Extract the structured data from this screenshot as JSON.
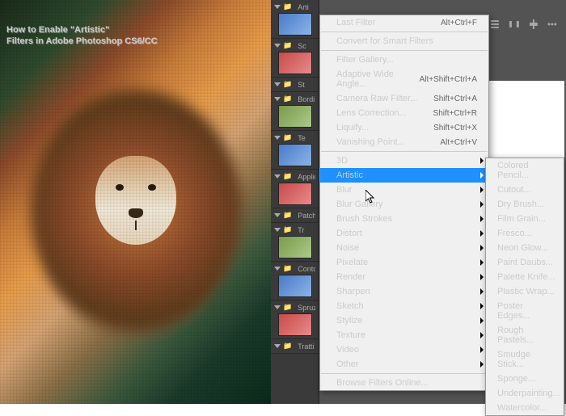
{
  "overlay": {
    "line1": "How to Enable \"Artistic\"",
    "line2": "Filters in Adobe Photoshop CS6/CC"
  },
  "panels": {
    "groups": [
      {
        "label": "Arti",
        "thumbs": 1
      },
      {
        "label": "Sc",
        "thumbs": 1
      },
      {
        "label": "St",
        "thumbs": 0
      },
      {
        "label": "Bordi brill",
        "thumbs": 1
      },
      {
        "label": "Te",
        "thumbs": 1
      },
      {
        "label": "Applica te",
        "thumbs": 1
      },
      {
        "label": "Patch",
        "thumbs": 0
      },
      {
        "label": "Tr",
        "thumbs": 1
      },
      {
        "label": "Contorni ac",
        "thumbs": 1
      },
      {
        "label": "Spruzz",
        "thumbs": 1
      },
      {
        "label": "Tratti ad",
        "thumbs": 0
      }
    ]
  },
  "filter_menu": {
    "last_filter": {
      "label": "Last Filter",
      "shortcut": "Alt+Ctrl+F"
    },
    "convert": "Convert for Smart Filters",
    "gallery": "Filter Gallery...",
    "adaptive": {
      "label": "Adaptive Wide Angle...",
      "shortcut": "Alt+Shift+Ctrl+A"
    },
    "camera_raw": {
      "label": "Camera Raw Filter...",
      "shortcut": "Shift+Ctrl+A"
    },
    "lens": {
      "label": "Lens Correction...",
      "shortcut": "Shift+Ctrl+R"
    },
    "liquify": {
      "label": "Liquify...",
      "shortcut": "Shift+Ctrl+X"
    },
    "vanishing": {
      "label": "Vanishing Point...",
      "shortcut": "Alt+Ctrl+V"
    },
    "categories": [
      "3D",
      "Artistic",
      "Blur",
      "Blur Gallery",
      "Brush Strokes",
      "Distort",
      "Noise",
      "Pixelate",
      "Render",
      "Sharpen",
      "Sketch",
      "Stylize",
      "Texture",
      "Video",
      "Other"
    ],
    "browse": "Browse Filters Online..."
  },
  "artistic_submenu": [
    "Colored Pencil...",
    "Cutout...",
    "Dry Brush...",
    "Film Grain...",
    "Fresco...",
    "Neon Glow...",
    "Paint Daubs...",
    "Palette Knife...",
    "Plastic Wrap...",
    "Poster Edges...",
    "Rough Pastels...",
    "Smudge Stick...",
    "Sponge...",
    "Underpainting...",
    "Watercolor..."
  ],
  "highlighted_category": "Artistic"
}
